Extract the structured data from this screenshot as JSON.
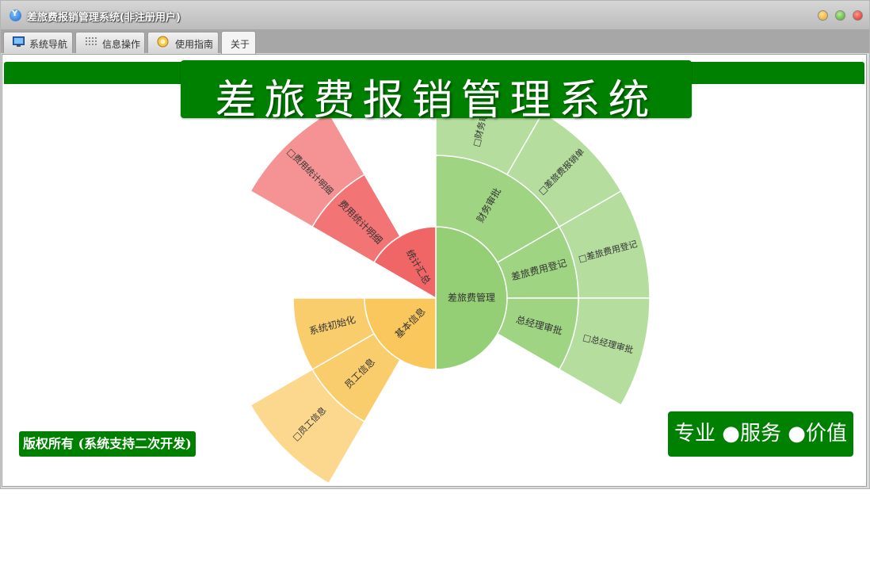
{
  "window": {
    "title": "差旅费报销管理系统(非注册用户)"
  },
  "tabs": [
    {
      "label": "系统导航",
      "icon": "monitor-icon"
    },
    {
      "label": "信息操作",
      "icon": "grid-icon"
    },
    {
      "label": "使用指南",
      "icon": "guide-icon"
    },
    {
      "label": "关于",
      "active": true
    }
  ],
  "banner": {
    "title": "差旅费报销管理系统"
  },
  "footer": {
    "copyright": "版权所有 (系统支持二次开发)",
    "slogan": "专业 ●服务 ●价值"
  },
  "colors": {
    "brand_green": "#008000",
    "red": "#f06566",
    "yellow": "#f9c75c",
    "green": "#94cf75"
  },
  "chart_data": {
    "type": "sunburst",
    "nodes": [
      {
        "name": "差旅费管理",
        "color": "#94cf75",
        "children": [
          {
            "name": "财务审批",
            "children": [
              {
                "name": "□财务审批"
              },
              {
                "name": "□差旅费报销单"
              }
            ]
          },
          {
            "name": "差旅费用登记",
            "children": [
              {
                "name": "□差旅费用登记"
              }
            ]
          },
          {
            "name": "总经理审批",
            "children": [
              {
                "name": "□总经理审批"
              }
            ]
          }
        ]
      },
      {
        "name": "基本信息",
        "color": "#f9c75c",
        "children": [
          {
            "name": "员工信息",
            "children": [
              {
                "name": "□员工信息"
              }
            ]
          },
          {
            "name": "系统初始化"
          }
        ]
      },
      {
        "name": "统计汇总",
        "color": "#f06566",
        "children": [
          {
            "name": "费用统计明细",
            "children": [
              {
                "name": "□费用统计明细"
              }
            ]
          }
        ]
      }
    ]
  }
}
